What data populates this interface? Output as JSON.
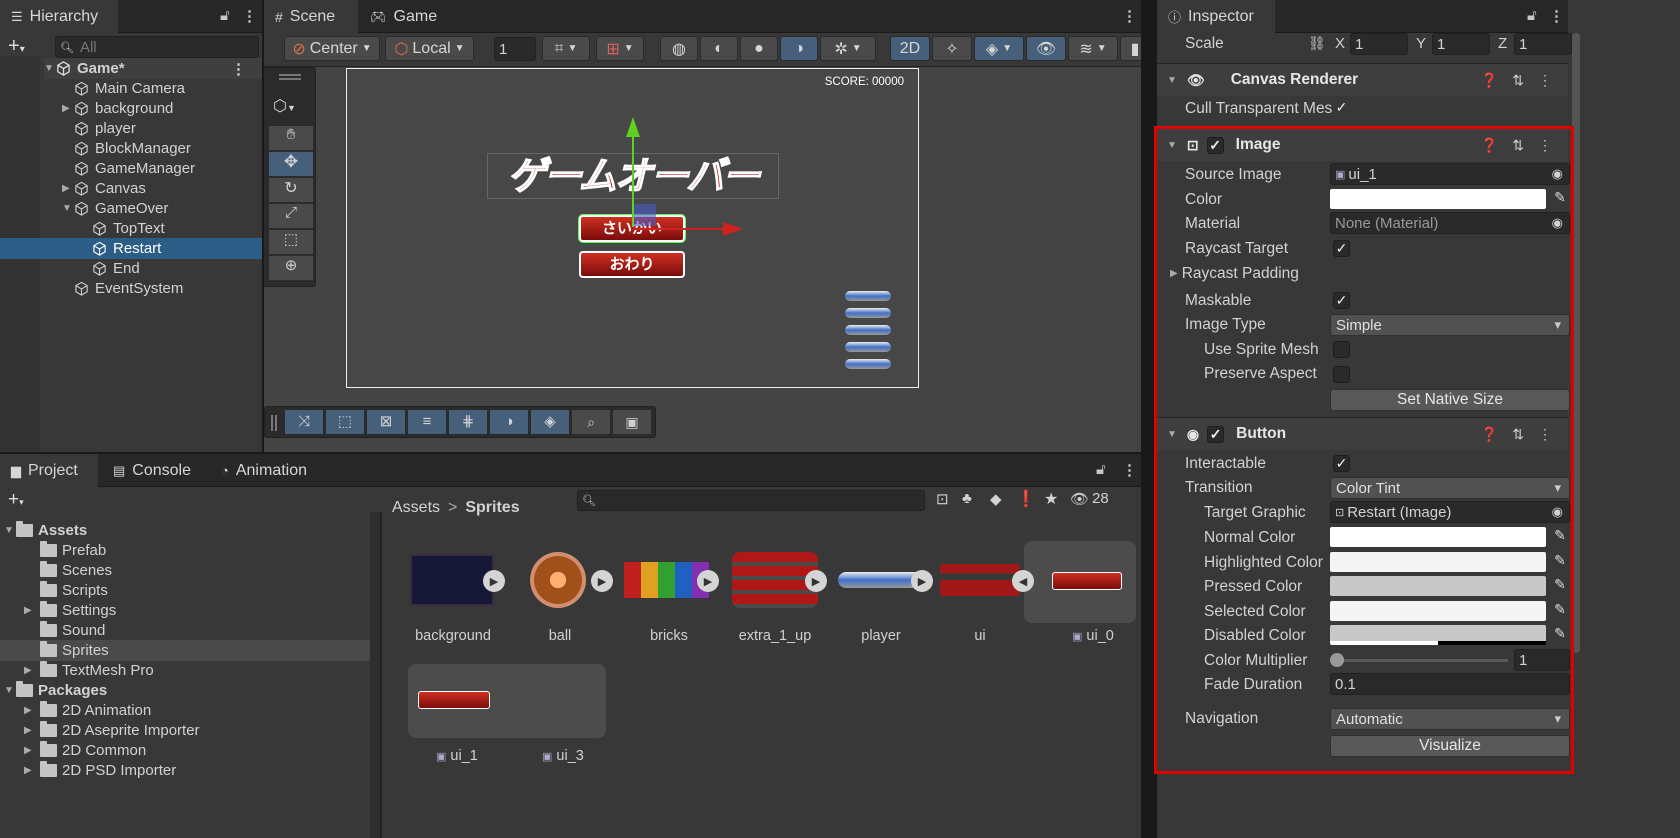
{
  "hierarchy": {
    "tab_label": "Hierarchy",
    "search_placeholder": "All",
    "items": [
      {
        "label": "Game*"
      },
      {
        "label": "Main Camera"
      },
      {
        "label": "background"
      },
      {
        "label": "player"
      },
      {
        "label": "BlockManager"
      },
      {
        "label": "GameManager"
      },
      {
        "label": "Canvas"
      },
      {
        "label": "GameOver"
      },
      {
        "label": "TopText"
      },
      {
        "label": "Restart"
      },
      {
        "label": "End"
      },
      {
        "label": "EventSystem"
      }
    ]
  },
  "scene": {
    "tabs": [
      {
        "label": "Scene"
      },
      {
        "label": "Game"
      }
    ],
    "toolbar": {
      "pivot": "Center",
      "space": "Local",
      "grid_size": "1",
      "mode_2d": "2D"
    },
    "canvas": {
      "score": "SCORE: 00000",
      "title_text": "ゲームオーバー",
      "restart_text": "さいかい",
      "end_text": "おわり"
    }
  },
  "project": {
    "tabs": [
      {
        "label": "Project"
      },
      {
        "label": "Console"
      },
      {
        "label": "Animation"
      }
    ],
    "hidden_count": "28",
    "tree": [
      {
        "label": "Assets"
      },
      {
        "label": "Prefab"
      },
      {
        "label": "Scenes"
      },
      {
        "label": "Scripts"
      },
      {
        "label": "Settings"
      },
      {
        "label": "Sound"
      },
      {
        "label": "Sprites"
      },
      {
        "label": "TextMesh Pro"
      },
      {
        "label": "Packages"
      },
      {
        "label": "2D Animation"
      },
      {
        "label": "2D Aseprite Importer"
      },
      {
        "label": "2D Common"
      },
      {
        "label": "2D PSD Importer"
      }
    ],
    "breadcrumb": {
      "root": "Assets",
      "separator": ">",
      "current": "Sprites"
    },
    "assets": [
      {
        "label": "background"
      },
      {
        "label": "ball"
      },
      {
        "label": "bricks"
      },
      {
        "label": "extra_1_up"
      },
      {
        "label": "player"
      },
      {
        "label": "ui"
      },
      {
        "label": "ui_0"
      },
      {
        "label": "ui_1"
      },
      {
        "label": "ui_3"
      }
    ]
  },
  "inspector": {
    "tab_label": "Inspector",
    "scale": {
      "label": "Scale",
      "x_label": "X",
      "x": "1",
      "y_label": "Y",
      "y": "1",
      "z_label": "Z",
      "z": "1"
    },
    "canvas_renderer": {
      "title": "Canvas Renderer",
      "cull_label": "Cull Transparent Mes"
    },
    "image": {
      "title": "Image",
      "source_image_label": "Source Image",
      "source_image": "ui_1",
      "color_label": "Color",
      "material_label": "Material",
      "material": "None (Material)",
      "raycast_target_label": "Raycast Target",
      "raycast_padding_label": "Raycast Padding",
      "maskable_label": "Maskable",
      "image_type_label": "Image Type",
      "image_type": "Simple",
      "use_sprite_mesh_label": "Use Sprite Mesh",
      "preserve_aspect_label": "Preserve Aspect",
      "set_native_size": "Set Native Size"
    },
    "button": {
      "title": "Button",
      "interactable_label": "Interactable",
      "transition_label": "Transition",
      "transition": "Color Tint",
      "target_graphic_label": "Target Graphic",
      "target_graphic": "Restart (Image)",
      "normal_color_label": "Normal Color",
      "highlighted_color_label": "Highlighted Color",
      "pressed_color_label": "Pressed Color",
      "selected_color_label": "Selected Color",
      "disabled_color_label": "Disabled Color",
      "color_multiplier_label": "Color Multiplier",
      "color_multiplier": "1",
      "fade_duration_label": "Fade Duration",
      "fade_duration": "0.1",
      "navigation_label": "Navigation",
      "navigation": "Automatic",
      "visualize": "Visualize"
    }
  },
  "colors": {
    "selection": "#2c5d87",
    "highlight_border": "#e00000",
    "panel": "#383838"
  }
}
